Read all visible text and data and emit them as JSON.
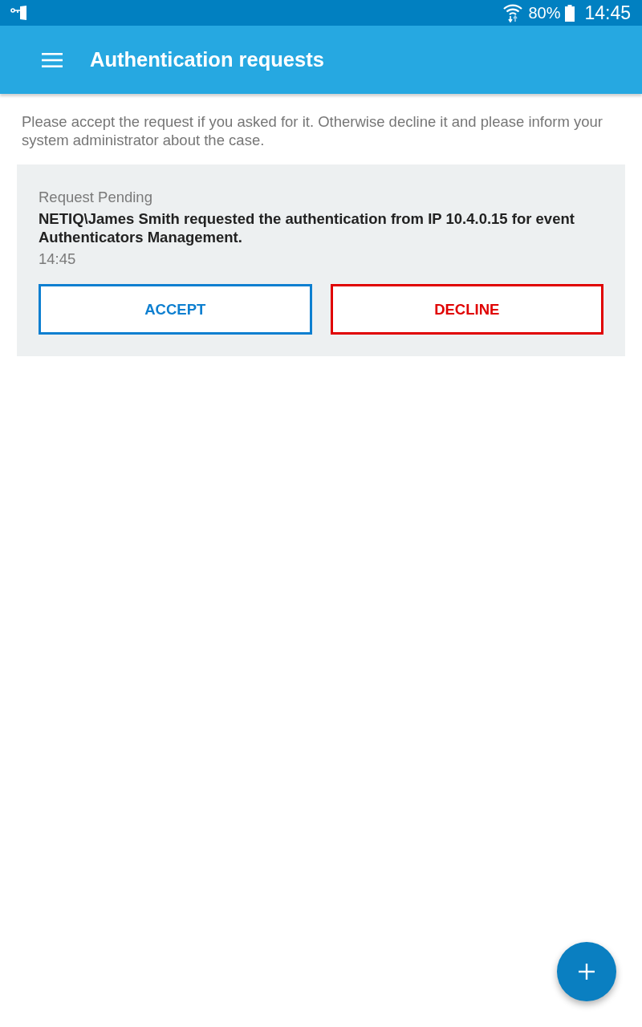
{
  "status_bar": {
    "battery": "80%",
    "time": "14:45"
  },
  "app_bar": {
    "title": "Authentication requests"
  },
  "intro": "Please accept the request if you asked for it. Otherwise decline it and please inform your system administrator about the case.",
  "requests": [
    {
      "status": "Request Pending",
      "message": "NETIQ\\James Smith requested the authentication from IP 10.4.0.15 for event Authenticators Management.",
      "time": "14:45",
      "actions": [
        {
          "label": "ACCEPT",
          "kind": "accept"
        },
        {
          "label": "DECLINE",
          "kind": "decline"
        }
      ]
    }
  ]
}
